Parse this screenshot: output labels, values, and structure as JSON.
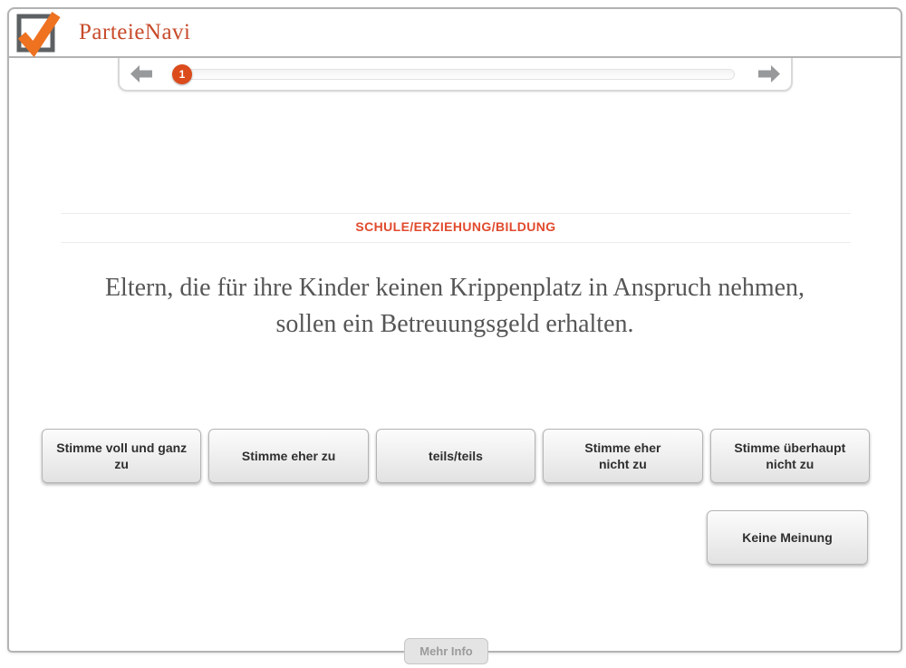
{
  "header": {
    "app_title": "ParteieNavi"
  },
  "progress": {
    "current_step": "1"
  },
  "category": {
    "label": "SCHULE/ERZIEHUNG/BILDUNG"
  },
  "question": {
    "text": "Eltern, die für ihre Kinder keinen Krippenplatz in Anspruch nehmen, sollen ein Betreuungsgeld erhalten."
  },
  "answers": {
    "options": [
      {
        "label": "Stimme voll und ganz zu"
      },
      {
        "label": "Stimme eher zu"
      },
      {
        "label": "teils/teils"
      },
      {
        "label": "Stimme eher nicht zu"
      },
      {
        "label": "Stimme überhaupt nicht zu"
      }
    ],
    "no_opinion_label": "Keine Meinung"
  },
  "footer": {
    "more_info_label": "Mehr Info"
  },
  "icons": {
    "logo": "checkbox-checkmark-icon",
    "prev": "arrow-left-icon",
    "next": "arrow-right-icon"
  },
  "colors": {
    "accent_orange": "#ee7220",
    "badge_orange": "#dc4b1c",
    "title_red": "#c84b2b",
    "category_red": "#e14a2d",
    "frame_gray": "#b3b3b3",
    "arrow_gray": "#97999b",
    "button_text": "#2f2f2f"
  }
}
